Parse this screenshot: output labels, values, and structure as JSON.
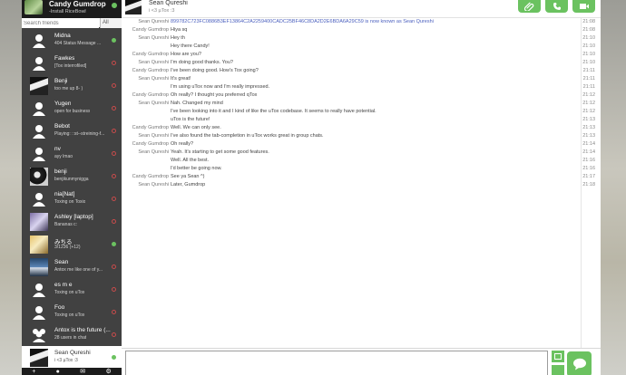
{
  "colors": {
    "accent": "#6bc260",
    "sidebar": "#414141",
    "offline": "#c84b4b",
    "link": "#4a5fbe"
  },
  "self": {
    "name": "Candy Gumdrop",
    "status": "-Install RiceBowl"
  },
  "search": {
    "placeholder": "Search friends",
    "filter": "All"
  },
  "friends": [
    {
      "name": "Midna",
      "status": "404 Status Message ...",
      "presence": "online",
      "avatar": "default"
    },
    {
      "name": "Fawkes",
      "status": "[Tox interrofiled]",
      "presence": "offline",
      "avatar": "default"
    },
    {
      "name": "Benji",
      "status": "too me up 8- )",
      "presence": "offline",
      "avatar": "photo"
    },
    {
      "name": "Yugen",
      "status": "open for business",
      "presence": "offline",
      "avatar": "default"
    },
    {
      "name": "Bebot",
      "status": "Playing: ::st--streining-f...",
      "presence": "offline",
      "avatar": "default"
    },
    {
      "name": "nv",
      "status": "ayy lmao",
      "presence": "offline",
      "avatar": "default"
    },
    {
      "name": "benji",
      "status": "benjikunmynigga",
      "presence": "offline",
      "avatar": "photo"
    },
    {
      "name": "nia[Nat]",
      "status": "Toxing on Toxio",
      "presence": "offline",
      "avatar": "default"
    },
    {
      "name": "Ashley [laptop]",
      "status": "Bananas c:",
      "presence": "offline",
      "avatar": "photo"
    },
    {
      "name": "みちる",
      "status": "3/1236 (+12)",
      "presence": "online",
      "avatar": "photo"
    },
    {
      "name": "Sean",
      "status": "Antox me like one of y...",
      "presence": "offline",
      "avatar": "photo"
    },
    {
      "name": "es m e",
      "status": "Toxing on uTox",
      "presence": "offline",
      "avatar": "default"
    },
    {
      "name": "Foo",
      "status": "Toxing on uTox",
      "presence": "offline",
      "avatar": "default"
    },
    {
      "name": "Antox is the future (...",
      "status": "28 users in chat",
      "presence": "offline",
      "avatar": "group"
    },
    {
      "name": "Sean Qureshi",
      "status": "i <3 µTox :3",
      "presence": "online",
      "avatar": "photo",
      "selected": true
    }
  ],
  "bottombar": {
    "icons": [
      "plus-icon",
      "users-icon",
      "envelope-icon",
      "gear-icon"
    ]
  },
  "chat": {
    "name": "Sean Qureshi",
    "status": "i <3 µTox :3",
    "buttons": [
      "paperclip-icon",
      "phone-icon",
      "video-icon"
    ]
  },
  "messages": [
    {
      "author": "Sean Qureshi",
      "text": "899782C723FC0886B3EF13864C2A2259400CADC25BF46C8DA2D2E6BDA6A29C59 is now known as Sean Qureshi",
      "time": "21:08",
      "pk": true
    },
    {
      "author": "Candy Gumdrop",
      "text": "Hiya sq",
      "time": "21:08"
    },
    {
      "author": "Sean Qureshi",
      "text": "Hey th",
      "time": "21:10"
    },
    {
      "author": "",
      "text": "Hey there Candy!",
      "time": "21:10"
    },
    {
      "author": "Candy Gumdrop",
      "text": "How are you?",
      "time": "21:10"
    },
    {
      "author": "Sean Qureshi",
      "text": "I'm doing good thanks. You?",
      "time": "21:10"
    },
    {
      "author": "Candy Gumdrop",
      "text": "I've been doing good.  How's Tox going?",
      "time": "21:11"
    },
    {
      "author": "Sean Qureshi",
      "text": "It's great!",
      "time": "21:11"
    },
    {
      "author": "",
      "text": "I'm using uTox now and I'm really impressed.",
      "time": "21:11"
    },
    {
      "author": "Candy Gumdrop",
      "text": "Oh really?  I thought you preferred qTox",
      "time": "21:12"
    },
    {
      "author": "Sean Qureshi",
      "text": "Nah.  Changed my mind",
      "time": "21:12"
    },
    {
      "author": "",
      "text": "I've been looking into it and I kind of like the uTox codebase.  It seems to really have potential.",
      "time": "21:12"
    },
    {
      "author": "",
      "text": "uTox is the future!",
      "time": "21:13"
    },
    {
      "author": "Candy Gumdrop",
      "text": "Well.  We can only see.",
      "time": "21:13"
    },
    {
      "author": "Sean Qureshi",
      "text": "I've also found the tab-completion in uTox works great in group chats.",
      "time": "21:13"
    },
    {
      "author": "Candy Gumdrop",
      "text": "Oh really?",
      "time": "21:14"
    },
    {
      "author": "Sean Qureshi",
      "text": "Yeah.  It's starting to get some good features.",
      "time": "21:14"
    },
    {
      "author": "",
      "text": "Well.  All the best.",
      "time": "21:16"
    },
    {
      "author": "",
      "text": "I'd better be going now.",
      "time": "21:16"
    },
    {
      "author": "Candy Gumdrop",
      "text": "See ya Sean ^)",
      "time": "21:17"
    },
    {
      "author": "Sean Qureshi",
      "text": "Later, Gumdrop",
      "time": "21:18"
    }
  ],
  "composer": {
    "value": ""
  }
}
